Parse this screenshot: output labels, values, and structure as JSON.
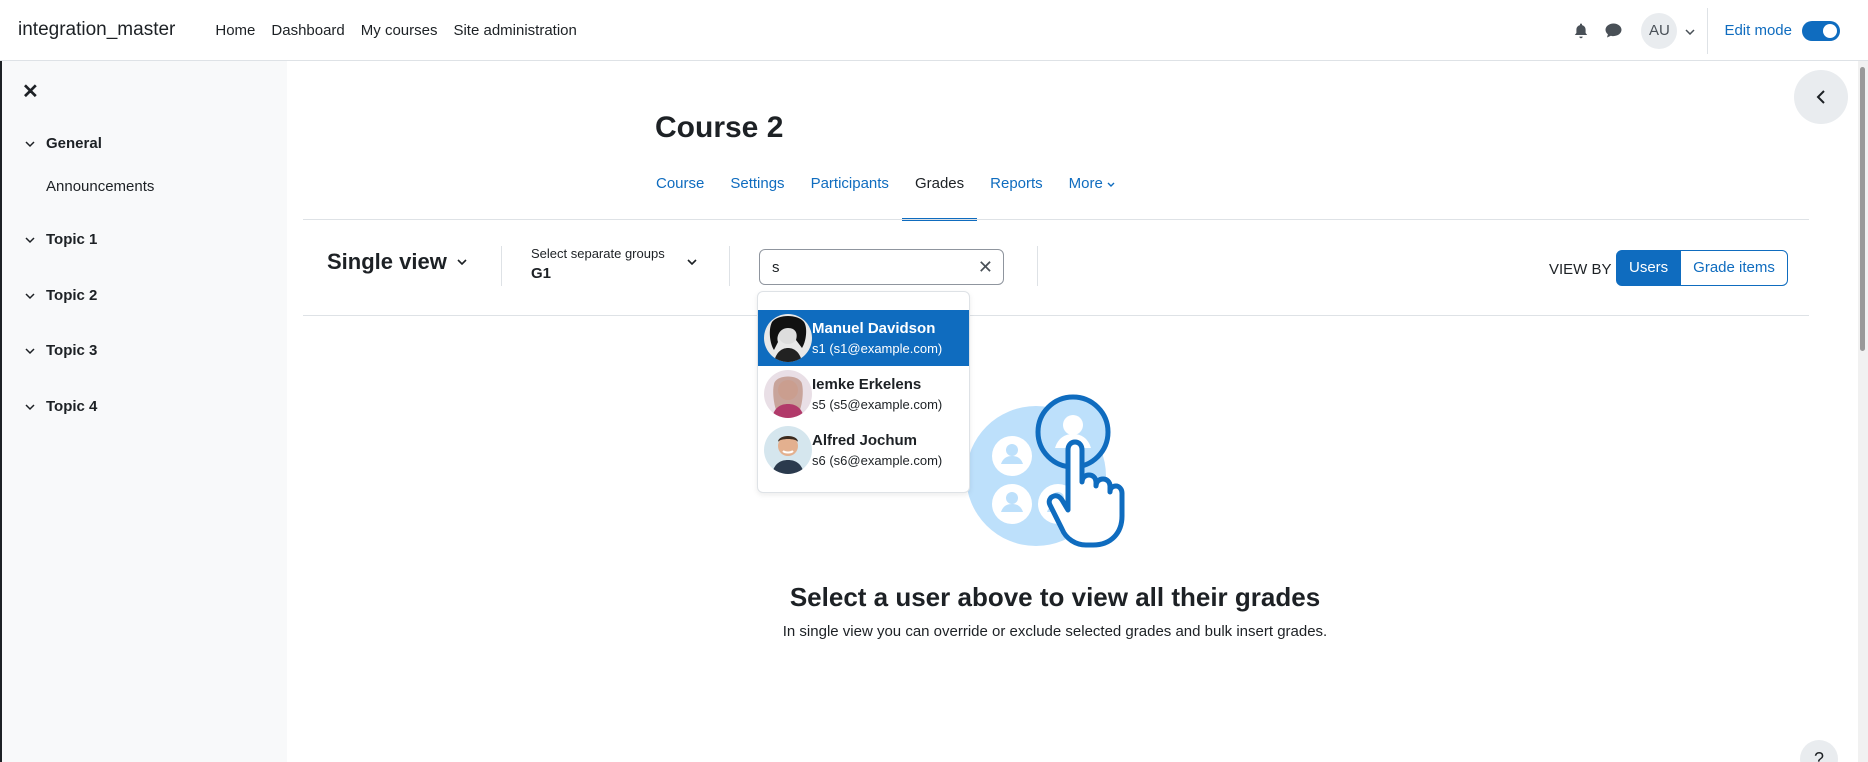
{
  "navbar": {
    "brand": "integration_master",
    "links": [
      "Home",
      "Dashboard",
      "My courses",
      "Site administration"
    ],
    "user_initials": "AU",
    "edit_mode_label": "Edit mode",
    "edit_mode_on": true
  },
  "drawer": {
    "sections": [
      {
        "title": "General",
        "items": [
          "Announcements"
        ]
      },
      {
        "title": "Topic 1",
        "items": []
      },
      {
        "title": "Topic 2",
        "items": []
      },
      {
        "title": "Topic 3",
        "items": []
      },
      {
        "title": "Topic 4",
        "items": []
      }
    ]
  },
  "course": {
    "title": "Course 2",
    "tabs": [
      "Course",
      "Settings",
      "Participants",
      "Grades",
      "Reports",
      "More"
    ],
    "active_tab": "Grades"
  },
  "toolbar": {
    "report_name": "Single view",
    "group_label": "Select separate groups",
    "group_value": "G1",
    "search_value": "s",
    "view_by_label": "VIEW BY",
    "view_by_options": [
      "Users",
      "Grade items"
    ],
    "view_by_selected": "Users"
  },
  "dropdown": {
    "users": [
      {
        "name": "Manuel Davidson",
        "detail": "s1 (s1@example.com)"
      },
      {
        "name": "Iemke Erkelens",
        "detail": "s5 (s5@example.com)"
      },
      {
        "name": "Alfred Jochum",
        "detail": "s6 (s6@example.com)"
      }
    ]
  },
  "empty_state": {
    "title": "Select a user above to view all their grades",
    "subtitle": "In single view you can override or exclude selected grades and bulk insert grades."
  },
  "help_label": "?",
  "colors": {
    "primary": "#0f6cbf",
    "drawer_bg": "#f8f9fa",
    "illustration_light": "#bde0fb",
    "illustration_dark": "#0f6cbf"
  }
}
